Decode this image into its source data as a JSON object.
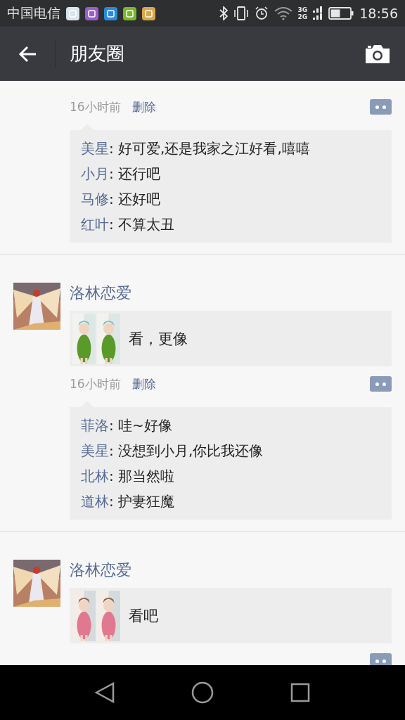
{
  "status_bar": {
    "carrier": "中国电信",
    "network": "3G",
    "network_2": "2G",
    "time": "18:56"
  },
  "title_bar": {
    "title": "朋友圈"
  },
  "posts": [
    {
      "time": "16小时前",
      "delete_label": "删除",
      "comments": [
        {
          "name": "美星",
          "text": ": 好可爱,还是我家之江好看,嘻嘻"
        },
        {
          "name": "小月",
          "text": ": 还行吧"
        },
        {
          "name": "马修",
          "text": ": 还好吧"
        },
        {
          "name": "红叶",
          "text": ": 不算太丑"
        }
      ]
    },
    {
      "author": "洛林恋爱",
      "share": {
        "text": "看，更像"
      },
      "time": "16小时前",
      "delete_label": "删除",
      "comments": [
        {
          "name": "菲洛",
          "text": ": 哇~好像"
        },
        {
          "name": "美星",
          "text": ": 没想到小月,你比我还像"
        },
        {
          "name": "北林",
          "text": ": 那当然啦"
        },
        {
          "name": "道林",
          "text": ": 护妻狂魔"
        }
      ]
    },
    {
      "author": "洛林恋爱",
      "share": {
        "text": "看吧"
      }
    }
  ]
}
